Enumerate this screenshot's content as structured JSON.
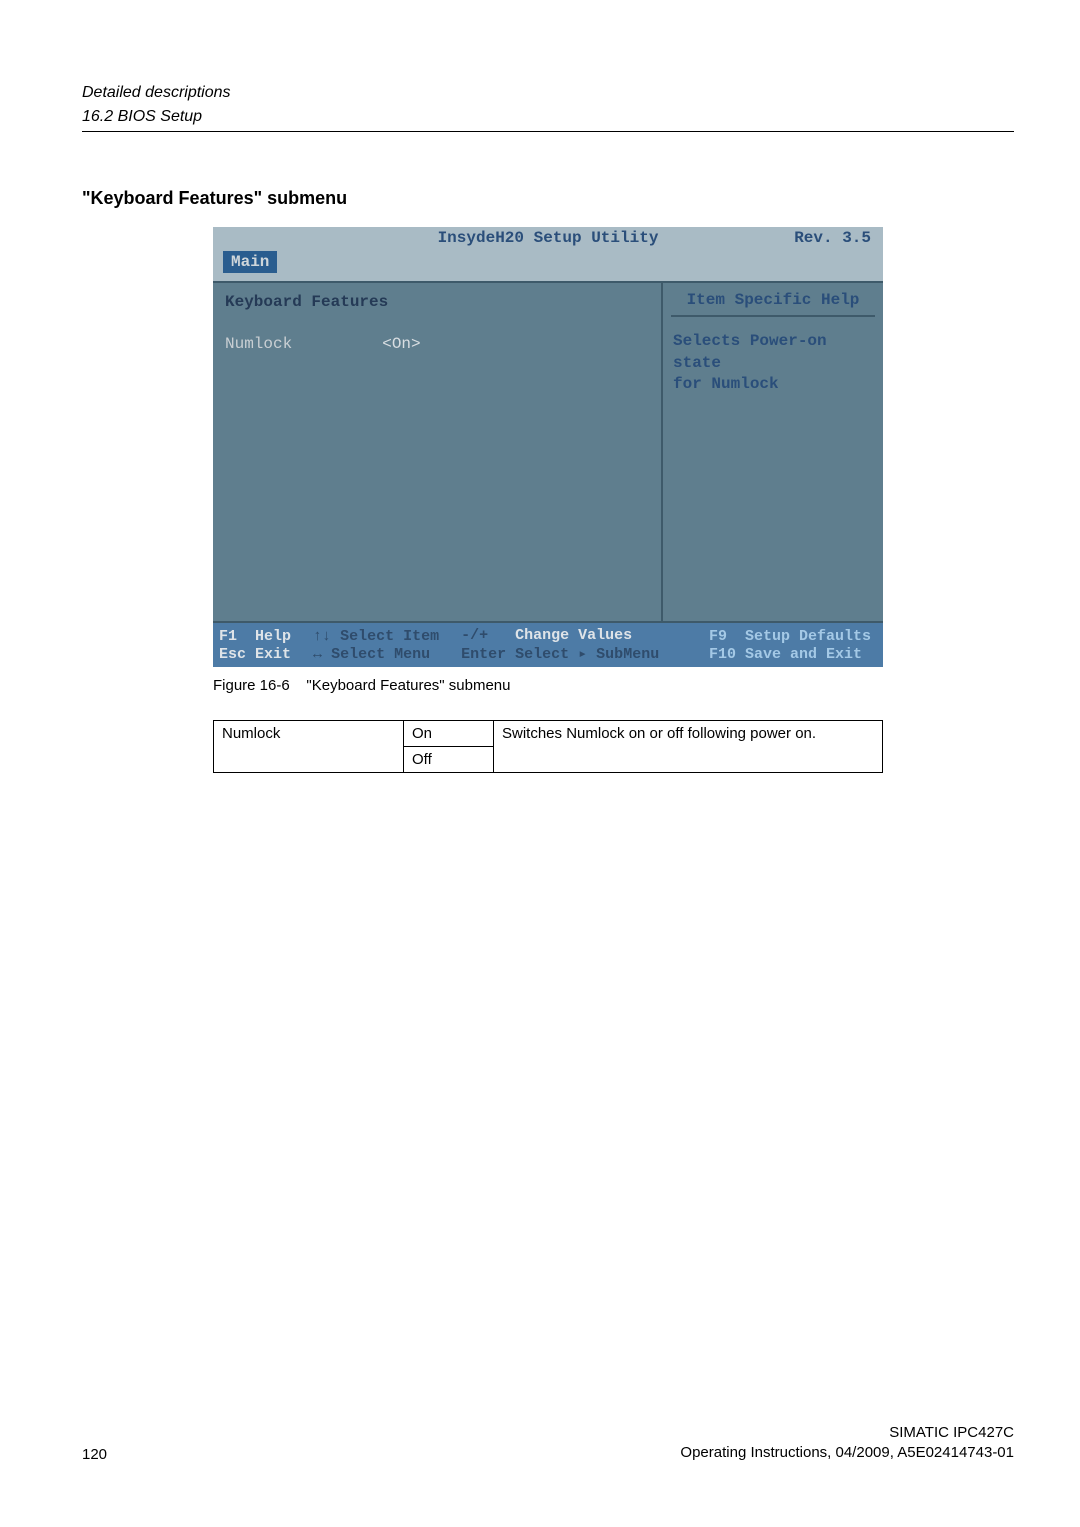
{
  "header": {
    "section": "Detailed descriptions",
    "subsection": "16.2 BIOS Setup"
  },
  "heading": "\"Keyboard Features\" submenu",
  "bios": {
    "title": "InsydeH20 Setup Utility",
    "rev": "Rev. 3.5",
    "tab": "Main",
    "left_heading": "Keyboard Features",
    "item_label": "Numlock",
    "item_value": "<On>",
    "help_heading": "Item Specific Help",
    "help_text_1": "Selects Power-on state",
    "help_text_2": "for Numlock",
    "footer": {
      "f1_key": "F1",
      "f1_lbl": "Help",
      "esc_key": "Esc",
      "esc_lbl": "Exit",
      "updown_key": "↑↓",
      "updown_lbl": "Select Item",
      "lr_key": "↔",
      "lr_lbl": "Select Menu",
      "pm_key": "-/+",
      "pm_lbl": "Change Values",
      "enter_key": "Enter",
      "enter_lbl": "Select ▸ SubMenu",
      "f9_key": "F9",
      "f9_lbl": "Setup Defaults",
      "f10_key": "F10",
      "f10_lbl": "Save and Exit"
    }
  },
  "figure_caption_label": "Figure 16-6",
  "figure_caption_text": "\"Keyboard Features\" submenu",
  "table": {
    "r1c1": "Numlock",
    "r1c2": "On",
    "r1c3": "Switches Numlock on or off following power on.",
    "r2c2": "Off"
  },
  "footer": {
    "page": "120",
    "product": "SIMATIC IPC427C",
    "docline": "Operating Instructions, 04/2009, A5E02414743-01"
  }
}
